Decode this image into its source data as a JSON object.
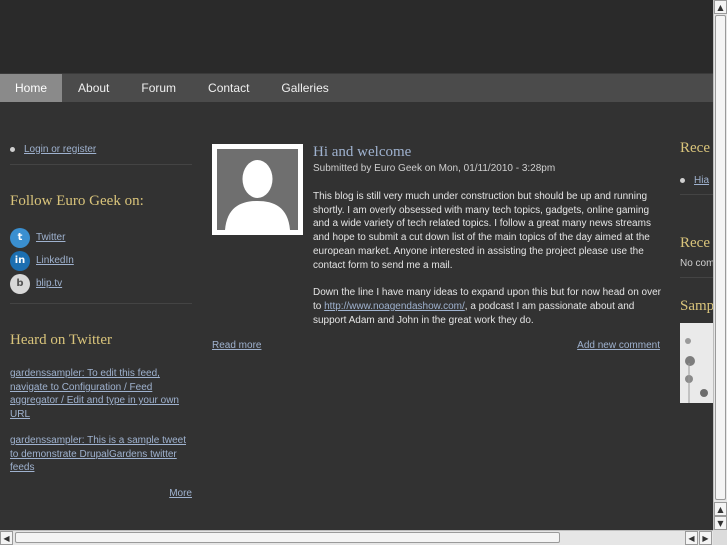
{
  "nav": {
    "items": [
      {
        "label": "Home",
        "active": true
      },
      {
        "label": "About"
      },
      {
        "label": "Forum"
      },
      {
        "label": "Contact"
      },
      {
        "label": "Galleries"
      }
    ]
  },
  "sidebar_left": {
    "login_link": "Login or register",
    "follow_title": "Follow Euro Geek on:",
    "social": [
      {
        "label": "Twitter",
        "icon": "twitter-icon"
      },
      {
        "label": "LinkedIn",
        "icon": "linkedin-icon"
      },
      {
        "label": "blip.tv",
        "icon": "bliptv-icon"
      }
    ],
    "twitter_title": "Heard on Twitter",
    "tweets": [
      "gardenssampler: To edit this feed, navigate to Configuration / Feed aggregator / Edit and type in your own URL",
      "gardenssampler: This is a sample tweet to demonstrate DrupalGardens twitter feeds"
    ],
    "more_link": "More"
  },
  "article": {
    "title": "Hi and welcome",
    "submitted": "Submitted by Euro Geek on Mon, 01/11/2010 - 3:28pm",
    "paragraph1": "This blog is still very much under construction but should be up and running shortly. I am overly obsessed with many tech topics, gadgets, online gaming and a wide variety of tech related topics. I follow a great many news streams and hope to submit a cut down list of the main topics of the day aimed at the european market. Anyone interested in assisting the project please use the contact form to send me a mail.",
    "paragraph2_before": "Down the line I have many ideas to expand upon this but for now head on over to ",
    "paragraph2_link": "http://www.noagendashow.com/",
    "paragraph2_after": ", a podcast I am passionate about and support Adam and John in the great work they do.",
    "read_more": "Read more",
    "add_comment": "Add new comment"
  },
  "sidebar_right": {
    "title1": "Rece",
    "item1": "Hia",
    "title2": "Rece",
    "item2": "No com",
    "title3": "Samp"
  },
  "colors": {
    "background": "#323232",
    "nav": "#4b4b4b",
    "nav_active": "#8a8a8a",
    "block_title": "#d9c47b",
    "link": "#9fb2cf"
  }
}
